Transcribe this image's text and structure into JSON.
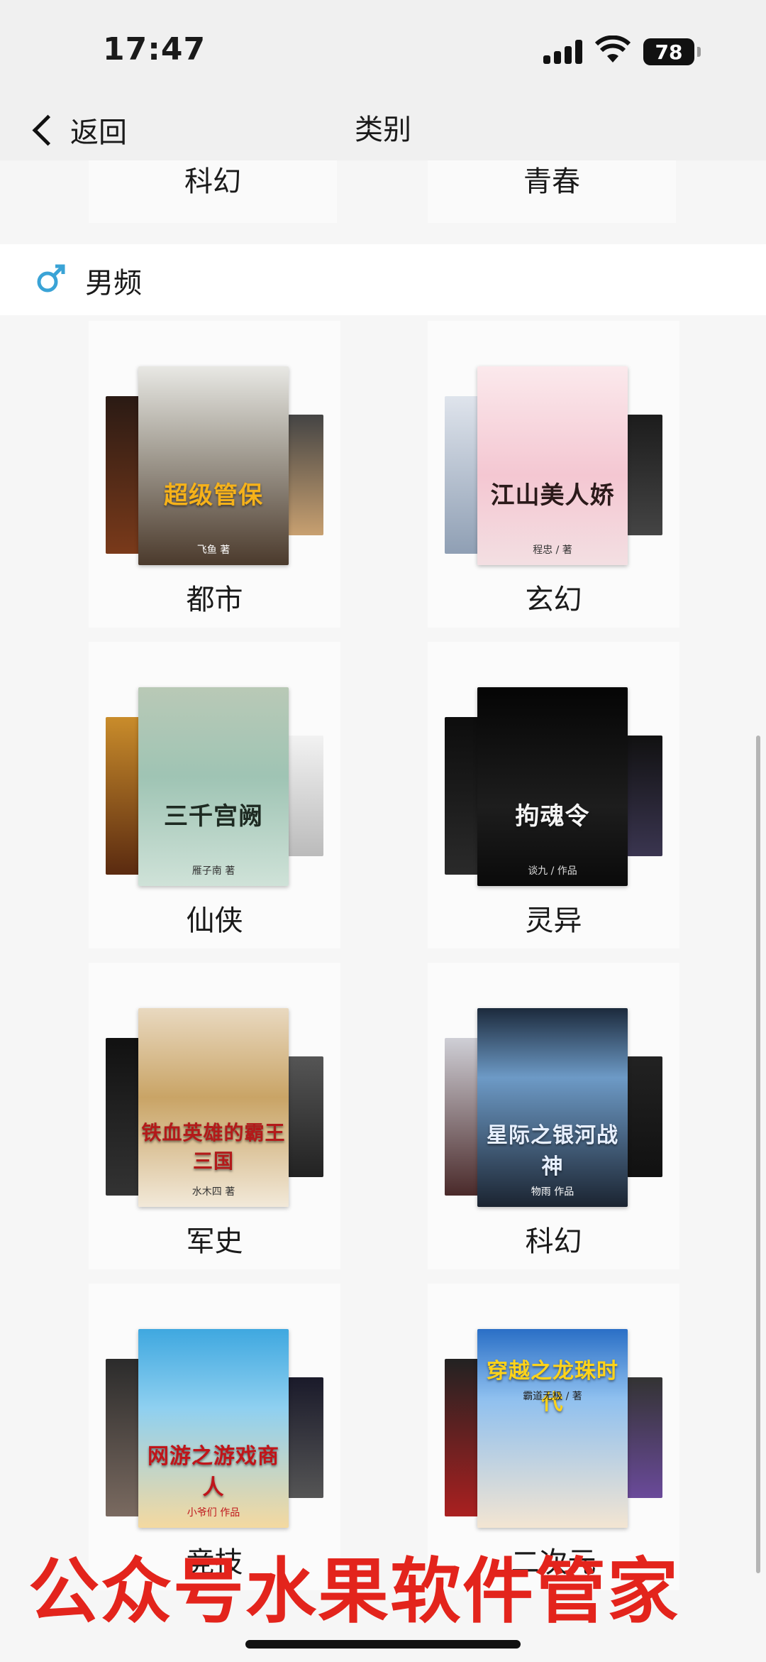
{
  "status_bar": {
    "time": "17:47",
    "battery": "78"
  },
  "nav": {
    "back_label": "返回",
    "title": "类别"
  },
  "previous_row": {
    "items": [
      "科幻",
      "青春"
    ]
  },
  "section": {
    "title": "男频"
  },
  "categories": [
    {
      "label": "都市",
      "cover_title": "超级管保",
      "cover_author": "飞鱼 著"
    },
    {
      "label": "玄幻",
      "cover_title": "江山美人娇",
      "cover_author": "程忠 / 著"
    },
    {
      "label": "仙侠",
      "cover_title": "三千宫阙",
      "cover_author": "雁子南 著"
    },
    {
      "label": "灵异",
      "cover_title": "拘魂令",
      "cover_author": "谈九 / 作品"
    },
    {
      "label": "军史",
      "cover_title": "铁血英雄的霸王三国",
      "cover_author": "水木四 著"
    },
    {
      "label": "科幻",
      "cover_title": "星际之银河战神",
      "cover_author": "物雨 作品"
    },
    {
      "label": "竞技",
      "cover_title": "网游之游戏商人",
      "cover_author": "小爷们 作品"
    },
    {
      "label": "二次元",
      "cover_title": "穿越之龙珠时代",
      "cover_author": "霸道无极 / 著"
    }
  ],
  "watermark": "公众号水果软件管家",
  "colors": {
    "watermark": "#e3241c",
    "background": "#f6f6f6",
    "male_icon": "#3aa3d6"
  }
}
